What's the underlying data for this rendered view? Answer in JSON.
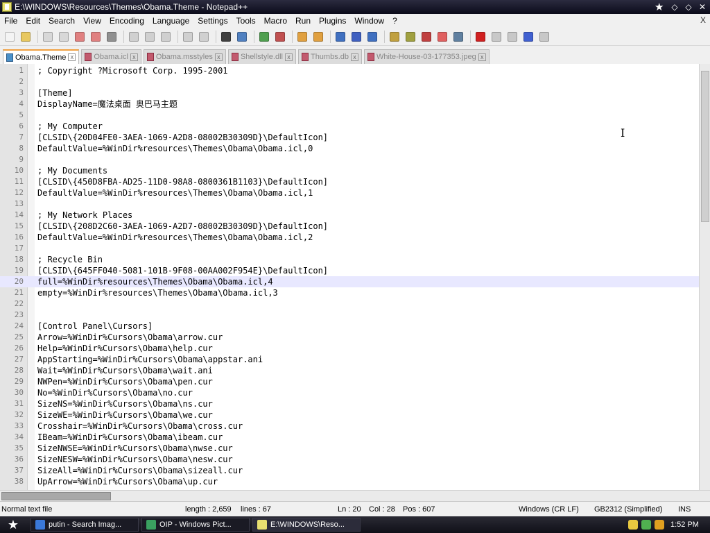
{
  "window": {
    "title": "E:\\WINDOWS\\Resources\\Themes\\Obama.Theme - Notepad++",
    "star_glyph": "★",
    "ctrl_glyphs": [
      "◇",
      "◇",
      "✕"
    ]
  },
  "menu": [
    "File",
    "Edit",
    "Search",
    "View",
    "Encoding",
    "Language",
    "Settings",
    "Tools",
    "Macro",
    "Run",
    "Plugins",
    "Window",
    "?"
  ],
  "menu_close": "X",
  "toolbar": [
    {
      "name": "new-file-icon",
      "color": "#f4f4f4"
    },
    {
      "name": "open-file-icon",
      "color": "#e8c860"
    },
    {
      "name": "save-icon",
      "color": "#d8d8d8"
    },
    {
      "name": "save-all-icon",
      "color": "#d8d8d8"
    },
    {
      "name": "close-icon",
      "color": "#e08080"
    },
    {
      "name": "close-all-icon",
      "color": "#e08080"
    },
    {
      "name": "print-icon",
      "color": "#909090"
    },
    {
      "name": "cut-icon",
      "color": "#d0d0d0"
    },
    {
      "name": "copy-icon",
      "color": "#d0d0d0"
    },
    {
      "name": "paste-icon",
      "color": "#d0d0d0"
    },
    {
      "name": "undo-icon",
      "color": "#d0d0d0"
    },
    {
      "name": "redo-icon",
      "color": "#d0d0d0"
    },
    {
      "name": "find-icon",
      "color": "#404040"
    },
    {
      "name": "replace-icon",
      "color": "#5080c0"
    },
    {
      "name": "zoom-in-icon",
      "color": "#50a050"
    },
    {
      "name": "zoom-out-icon",
      "color": "#c05050"
    },
    {
      "name": "sync-vertical-icon",
      "color": "#e0a040"
    },
    {
      "name": "sync-horizontal-icon",
      "color": "#e0a040"
    },
    {
      "name": "word-wrap-icon",
      "color": "#4070c0"
    },
    {
      "name": "show-all-chars-icon",
      "color": "#4060c0"
    },
    {
      "name": "indent-guide-icon",
      "color": "#4070c0"
    },
    {
      "name": "udl-icon",
      "color": "#c0a040"
    },
    {
      "name": "doc-map-icon",
      "color": "#a0a040"
    },
    {
      "name": "function-list-icon",
      "color": "#c04040"
    },
    {
      "name": "folder-workspace-icon",
      "color": "#e06060"
    },
    {
      "name": "monitor-icon",
      "color": "#6080a0"
    },
    {
      "name": "record-macro-icon",
      "color": "#d02020"
    },
    {
      "name": "stop-macro-icon",
      "color": "#c8c8c8"
    },
    {
      "name": "play-macro-icon",
      "color": "#c8c8c8"
    },
    {
      "name": "run-macro-icon",
      "color": "#4060d0"
    },
    {
      "name": "save-macro-icon",
      "color": "#c8c8c8"
    }
  ],
  "tabs": [
    {
      "label": "Obama.Theme",
      "active": true
    },
    {
      "label": "Obama.icl",
      "active": false
    },
    {
      "label": "Obama.msstyles",
      "active": false
    },
    {
      "label": "Shellstyle.dll",
      "active": false
    },
    {
      "label": "Thumbs.db",
      "active": false
    },
    {
      "label": "White-House-03-177353.jpeg",
      "active": false
    }
  ],
  "tab_close": "x",
  "editor": {
    "current_line": 20,
    "lines": [
      "; Copyright ?Microsoft Corp. 1995-2001",
      "",
      "[Theme]",
      "DisplayName=魔法桌面 奥巴马主题",
      "",
      "; My Computer",
      "[CLSID\\{20D04FE0-3AEA-1069-A2D8-08002B30309D}\\DefaultIcon]",
      "DefaultValue=%WinDir%resources\\Themes\\Obama\\Obama.icl,0",
      "",
      "; My Documents",
      "[CLSID\\{450D8FBA-AD25-11D0-98A8-0800361B1103}\\DefaultIcon]",
      "DefaultValue=%WinDir%resources\\Themes\\Obama\\Obama.icl,1",
      "",
      "; My Network Places",
      "[CLSID\\{208D2C60-3AEA-1069-A2D7-08002B30309D}\\DefaultIcon]",
      "DefaultValue=%WinDir%resources\\Themes\\Obama\\Obama.icl,2",
      "",
      "; Recycle Bin",
      "[CLSID\\{645FF040-5081-101B-9F08-00AA002F954E}\\DefaultIcon]",
      "full=%WinDir%resources\\Themes\\Obama\\Obama.icl,4",
      "empty=%WinDir%resources\\Themes\\Obama\\Obama.icl,3",
      "",
      "",
      "[Control Panel\\Cursors]",
      "Arrow=%WinDir%Cursors\\Obama\\arrow.cur",
      "Help=%WinDir%Cursors\\Obama\\help.cur",
      "AppStarting=%WinDir%Cursors\\Obama\\appstar.ani",
      "Wait=%WinDir%Cursors\\Obama\\wait.ani",
      "NWPen=%WinDir%Cursors\\Obama\\pen.cur",
      "No=%WinDir%Cursors\\Obama\\no.cur",
      "SizeNS=%WinDir%Cursors\\Obama\\ns.cur",
      "SizeWE=%WinDir%Cursors\\Obama\\we.cur",
      "Crosshair=%WinDir%Cursors\\Obama\\cross.cur",
      "IBeam=%WinDir%Cursors\\Obama\\ibeam.cur",
      "SizeNWSE=%WinDir%Cursors\\Obama\\nwse.cur",
      "SizeNESW=%WinDir%Cursors\\Obama\\nesw.cur",
      "SizeAll=%WinDir%Cursors\\Obama\\sizeall.cur",
      "UpArrow=%WinDir%Cursors\\Obama\\up.cur"
    ],
    "mouse_cursor_glyph": "I"
  },
  "status": {
    "file_type": "Normal text file",
    "length": "length : 2,659",
    "lines": "lines : 67",
    "ln": "Ln : 20",
    "col": "Col : 28",
    "pos": "Pos : 607",
    "eol": "Windows (CR LF)",
    "encoding": "GB2312 (Simplified)",
    "mode": "INS"
  },
  "taskbar": {
    "start_glyph": "★",
    "tasks": [
      {
        "label": "putin - Search Imag...",
        "icon_color": "#3a78d8",
        "active": false
      },
      {
        "label": "OIP - Windows Pict...",
        "icon_color": "#3aa060",
        "active": false
      },
      {
        "label": "E:\\WINDOWS\\Reso...",
        "icon_color": "#e8e070",
        "active": true
      }
    ],
    "tray_icons": [
      {
        "name": "shield-icon",
        "color": "#e8c840"
      },
      {
        "name": "network-icon",
        "color": "#50b050"
      },
      {
        "name": "search-icon",
        "color": "#e0a020"
      }
    ],
    "clock": "1:52 PM"
  }
}
